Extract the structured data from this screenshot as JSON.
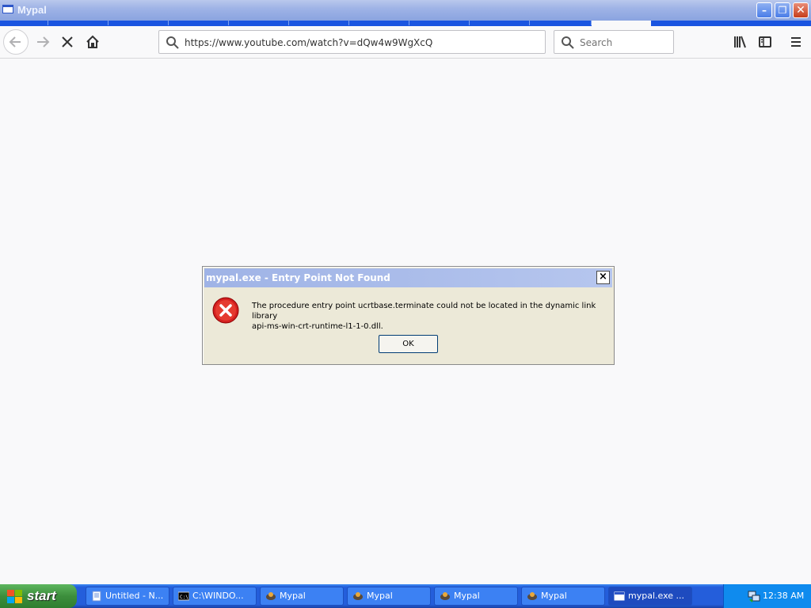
{
  "window": {
    "title": "Mypal"
  },
  "toolbar": {
    "url": "https://www.youtube.com/watch?v=dQw4w9WgXcQ",
    "search_placeholder": "Search",
    "icons": [
      "back-icon",
      "forward-icon",
      "stop-icon",
      "home-icon",
      "library-icon",
      "sidebar-icon",
      "menu-icon"
    ]
  },
  "dialog": {
    "title": "mypal.exe - Entry Point Not Found",
    "message_line1": "The procedure entry point ucrtbase.terminate could not be located in the dynamic link library",
    "message_line2": "api-ms-win-crt-runtime-l1-1-0.dll.",
    "ok_label": "OK",
    "close_label": "×",
    "icon": "error-icon"
  },
  "taskbar": {
    "start_label": "start",
    "tasks": [
      {
        "label": "Untitled - N...",
        "icon": "notepad-icon"
      },
      {
        "label": "C:\\WINDO...",
        "icon": "cmd-icon"
      },
      {
        "label": "Mypal",
        "icon": "mypal-icon"
      },
      {
        "label": "Mypal",
        "icon": "mypal-icon"
      },
      {
        "label": "Mypal",
        "icon": "mypal-icon"
      },
      {
        "label": "Mypal",
        "icon": "mypal-icon"
      },
      {
        "label": "mypal.exe ...",
        "icon": "window-icon"
      }
    ],
    "clock": "12:38 AM"
  },
  "colors": {
    "taskbar": "#245edb",
    "start": "#3c8e3c",
    "dialog_bg": "#ece9d8",
    "error": "#d42020"
  }
}
